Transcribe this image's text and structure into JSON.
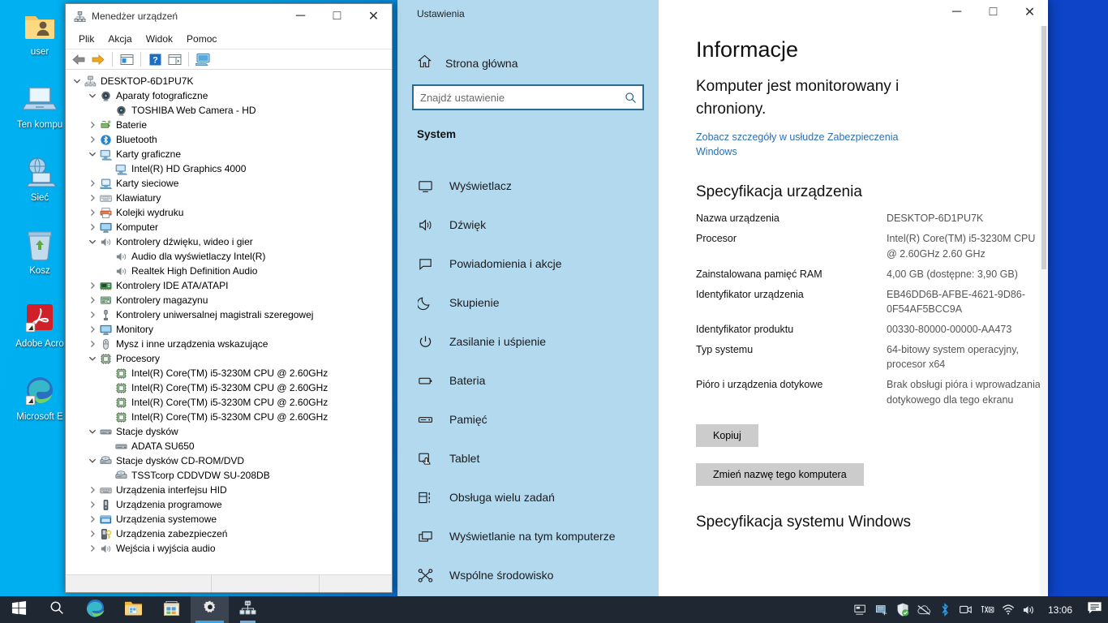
{
  "desktop": {
    "icons": [
      {
        "name": "user-folder",
        "label": "user",
        "icon": "folder-user-icon"
      },
      {
        "name": "this-pc",
        "label": "Ten kompu",
        "icon": "computer-icon"
      },
      {
        "name": "network",
        "label": "Sieć",
        "icon": "network-icon"
      },
      {
        "name": "recycle-bin",
        "label": "Kosz",
        "icon": "recycle-bin-icon"
      },
      {
        "name": "adobe-acrobat",
        "label": "Adobe Acro",
        "icon": "adobe-acrobat-icon"
      },
      {
        "name": "microsoft-edge",
        "label": "Microsoft E",
        "icon": "edge-icon"
      }
    ]
  },
  "device_manager": {
    "title": "Menedżer urządzeń",
    "title_icon": "device-manager-icon",
    "window_buttons": {
      "minimize": "─",
      "maximize": "□",
      "close": "✕"
    },
    "menu": [
      "Plik",
      "Akcja",
      "Widok",
      "Pomoc"
    ],
    "toolbar": [
      {
        "name": "back-icon",
        "glyph": "back-arrow"
      },
      {
        "name": "forward-icon",
        "glyph": "forward-arrow"
      },
      {
        "name": "separator-1",
        "glyph": "sep"
      },
      {
        "name": "properties-icon",
        "glyph": "properties"
      },
      {
        "name": "separator-2",
        "glyph": "sep"
      },
      {
        "name": "help-icon",
        "glyph": "help"
      },
      {
        "name": "show-hidden-icon",
        "glyph": "show-hidden"
      },
      {
        "name": "separator-3",
        "glyph": "sep"
      },
      {
        "name": "scan-hardware-icon",
        "glyph": "scan"
      }
    ],
    "tree": [
      {
        "level": 0,
        "state": "expanded",
        "icon": "computer-node-icon",
        "label": "DESKTOP-6D1PU7K"
      },
      {
        "level": 1,
        "state": "expanded",
        "icon": "camera-icon",
        "label": "Aparaty fotograficzne"
      },
      {
        "level": 2,
        "state": "leaf",
        "icon": "camera-icon",
        "label": "TOSHIBA Web Camera - HD"
      },
      {
        "level": 1,
        "state": "collapsed",
        "icon": "battery-icon",
        "label": "Baterie"
      },
      {
        "level": 1,
        "state": "collapsed",
        "icon": "bluetooth-icon",
        "label": "Bluetooth"
      },
      {
        "level": 1,
        "state": "expanded",
        "icon": "display-adapter-icon",
        "label": "Karty graficzne"
      },
      {
        "level": 2,
        "state": "leaf",
        "icon": "display-adapter-icon",
        "label": "Intel(R) HD Graphics 4000"
      },
      {
        "level": 1,
        "state": "collapsed",
        "icon": "network-adapter-icon",
        "label": "Karty sieciowe"
      },
      {
        "level": 1,
        "state": "collapsed",
        "icon": "keyboard-icon",
        "label": "Klawiatury"
      },
      {
        "level": 1,
        "state": "collapsed",
        "icon": "printer-icon",
        "label": "Kolejki wydruku"
      },
      {
        "level": 1,
        "state": "collapsed",
        "icon": "monitor-icon",
        "label": "Komputer"
      },
      {
        "level": 1,
        "state": "expanded",
        "icon": "sound-icon",
        "label": "Kontrolery dźwięku, wideo i gier"
      },
      {
        "level": 2,
        "state": "leaf",
        "icon": "sound-icon",
        "label": "Audio dla wyświetlaczy Intel(R)"
      },
      {
        "level": 2,
        "state": "leaf",
        "icon": "sound-icon",
        "label": "Realtek High Definition Audio"
      },
      {
        "level": 1,
        "state": "collapsed",
        "icon": "ide-controller-icon",
        "label": "Kontrolery IDE ATA/ATAPI"
      },
      {
        "level": 1,
        "state": "collapsed",
        "icon": "storage-controller-icon",
        "label": "Kontrolery magazynu"
      },
      {
        "level": 1,
        "state": "collapsed",
        "icon": "usb-icon",
        "label": "Kontrolery uniwersalnej magistrali szeregowej"
      },
      {
        "level": 1,
        "state": "collapsed",
        "icon": "monitor-icon",
        "label": "Monitory"
      },
      {
        "level": 1,
        "state": "collapsed",
        "icon": "mouse-icon",
        "label": "Mysz i inne urządzenia wskazujące"
      },
      {
        "level": 1,
        "state": "expanded",
        "icon": "processor-icon",
        "label": "Procesory"
      },
      {
        "level": 2,
        "state": "leaf",
        "icon": "processor-icon",
        "label": "Intel(R) Core(TM) i5-3230M CPU @ 2.60GHz"
      },
      {
        "level": 2,
        "state": "leaf",
        "icon": "processor-icon",
        "label": "Intel(R) Core(TM) i5-3230M CPU @ 2.60GHz"
      },
      {
        "level": 2,
        "state": "leaf",
        "icon": "processor-icon",
        "label": "Intel(R) Core(TM) i5-3230M CPU @ 2.60GHz"
      },
      {
        "level": 2,
        "state": "leaf",
        "icon": "processor-icon",
        "label": "Intel(R) Core(TM) i5-3230M CPU @ 2.60GHz"
      },
      {
        "level": 1,
        "state": "expanded",
        "icon": "disk-drive-icon",
        "label": "Stacje dysków"
      },
      {
        "level": 2,
        "state": "leaf",
        "icon": "disk-drive-icon",
        "label": "ADATA SU650"
      },
      {
        "level": 1,
        "state": "expanded",
        "icon": "dvd-drive-icon",
        "label": "Stacje dysków CD-ROM/DVD"
      },
      {
        "level": 2,
        "state": "leaf",
        "icon": "dvd-drive-icon",
        "label": "TSSTcorp CDDVDW SU-208DB"
      },
      {
        "level": 1,
        "state": "collapsed",
        "icon": "hid-icon",
        "label": "Urządzenia interfejsu HID"
      },
      {
        "level": 1,
        "state": "collapsed",
        "icon": "software-device-icon",
        "label": "Urządzenia programowe"
      },
      {
        "level": 1,
        "state": "collapsed",
        "icon": "system-device-icon",
        "label": "Urządzenia systemowe"
      },
      {
        "level": 1,
        "state": "collapsed",
        "icon": "security-device-icon",
        "label": "Urządzenia zabezpieczeń"
      },
      {
        "level": 1,
        "state": "collapsed",
        "icon": "audio-io-icon",
        "label": "Wejścia i wyjścia audio"
      }
    ]
  },
  "settings": {
    "app_title": "Ustawienia",
    "window_buttons": {
      "minimize": "─",
      "maximize": "□",
      "close": "✕"
    },
    "home_label": "Strona główna",
    "home_icon": "home-icon",
    "search": {
      "placeholder": "Znajdź ustawienie",
      "value": "",
      "icon": "search-icon"
    },
    "nav_heading": "System",
    "nav_items": [
      {
        "icon": "display-icon",
        "label": "Wyświetlacz"
      },
      {
        "icon": "sound-icon",
        "label": "Dźwięk"
      },
      {
        "icon": "notifications-icon",
        "label": "Powiadomienia i akcje"
      },
      {
        "icon": "focus-assist-icon",
        "label": "Skupienie"
      },
      {
        "icon": "power-icon",
        "label": "Zasilanie i uśpienie"
      },
      {
        "icon": "battery-icon",
        "label": "Bateria"
      },
      {
        "icon": "storage-icon",
        "label": "Pamięć"
      },
      {
        "icon": "tablet-icon",
        "label": "Tablet"
      },
      {
        "icon": "multitasking-icon",
        "label": "Obsługa wielu zadań"
      },
      {
        "icon": "projecting-icon",
        "label": "Wyświetlanie na tym komputerze"
      },
      {
        "icon": "shared-experiences-icon",
        "label": "Wspólne środowisko"
      }
    ],
    "page": {
      "title": "Informacje",
      "protection_status": "Komputer jest monitorowany i chroniony.",
      "security_link": "Zobacz szczegóły w usłudze Zabezpieczenia Windows",
      "device_spec_heading": "Specyfikacja urządzenia",
      "specs": [
        {
          "key": "Nazwa urządzenia",
          "value": "DESKTOP-6D1PU7K"
        },
        {
          "key": "Procesor",
          "value": "Intel(R) Core(TM) i5-3230M CPU @ 2.60GHz   2.60 GHz"
        },
        {
          "key": "Zainstalowana pamięć RAM",
          "value": "4,00 GB (dostępne: 3,90 GB)"
        },
        {
          "key": "Identyfikator urządzenia",
          "value": "EB46DD6B-AFBE-4621-9D86-0F54AF5BCC9A"
        },
        {
          "key": "Identyfikator produktu",
          "value": "00330-80000-00000-AA473"
        },
        {
          "key": "Typ systemu",
          "value": "64-bitowy system operacyjny, procesor x64"
        },
        {
          "key": "Pióro i urządzenia dotykowe",
          "value": "Brak obsługi pióra i wprowadzania dotykowego dla tego ekranu"
        }
      ],
      "copy_button": "Kopiuj",
      "rename_button": "Zmień nazwę tego komputera",
      "windows_spec_heading": "Specyfikacja systemu Windows"
    }
  },
  "taskbar": {
    "start": {
      "name": "start-button",
      "icon": "windows-logo-icon"
    },
    "items": [
      {
        "name": "search-taskbar-button",
        "icon": "search-icon",
        "state": "idle"
      },
      {
        "name": "edge-taskbar-button",
        "icon": "edge-icon",
        "state": "idle"
      },
      {
        "name": "file-explorer-taskbar-button",
        "icon": "file-explorer-icon",
        "state": "idle"
      },
      {
        "name": "store-taskbar-button",
        "icon": "store-icon",
        "state": "idle"
      },
      {
        "name": "settings-taskbar-button",
        "icon": "gear-icon",
        "state": "active"
      },
      {
        "name": "device-manager-taskbar-button",
        "icon": "device-manager-icon",
        "state": "open"
      }
    ],
    "tray": [
      {
        "name": "tray-display-icon",
        "icon": "display-icon"
      },
      {
        "name": "tray-network-icon",
        "icon": "network-icon"
      },
      {
        "name": "tray-security-icon",
        "icon": "shield-icon"
      },
      {
        "name": "tray-onedrive-icon",
        "icon": "cloud-offline-icon"
      },
      {
        "name": "tray-bluetooth-icon",
        "icon": "bluetooth-icon"
      },
      {
        "name": "tray-camera-icon",
        "icon": "camera-icon"
      },
      {
        "name": "tray-keyboard-icon",
        "icon": "keyboard-off-icon"
      },
      {
        "name": "tray-wifi-icon",
        "icon": "wifi-icon"
      },
      {
        "name": "tray-volume-icon",
        "icon": "volume-icon"
      }
    ],
    "clock": "13:06",
    "action_center": {
      "name": "action-center-button",
      "icon": "notification-icon"
    }
  }
}
